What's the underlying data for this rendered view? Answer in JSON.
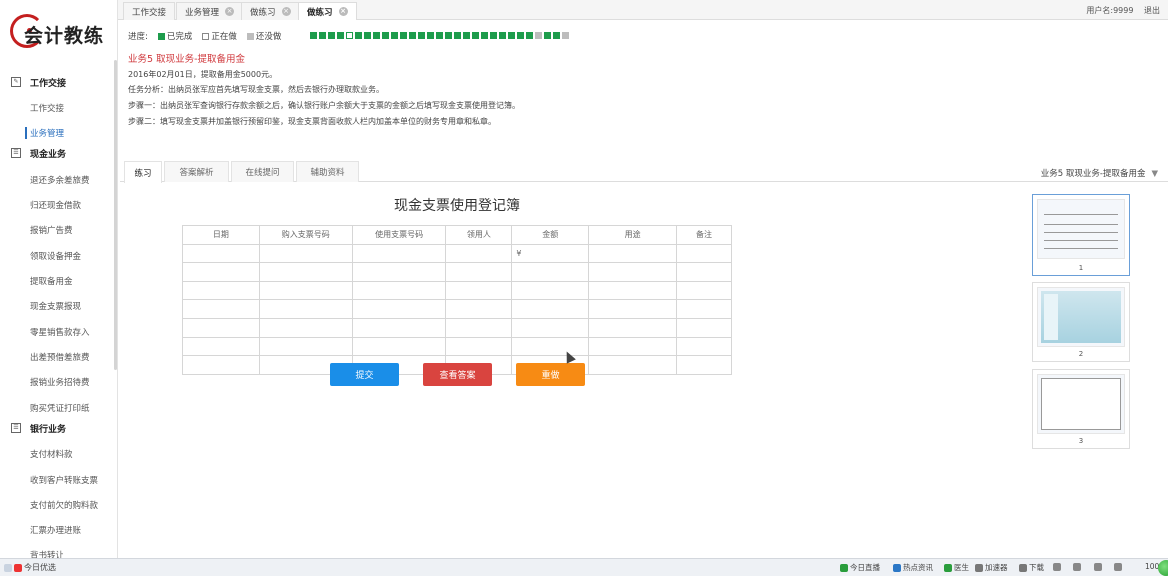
{
  "logo": {
    "text": "会计教练"
  },
  "sidebar": {
    "sections": [
      {
        "icon": "edit-icon",
        "label": "工作交接",
        "items": [
          {
            "label": "工作交接",
            "active": false
          },
          {
            "label": "业务管理",
            "active": true
          }
        ]
      },
      {
        "icon": "list-icon",
        "label": "现金业务",
        "items": [
          {
            "label": "退还多余差旅费"
          },
          {
            "label": "归还现金借款"
          },
          {
            "label": "报销广告费"
          },
          {
            "label": "领取设备押金"
          },
          {
            "label": "提取备用金"
          },
          {
            "label": "现金支票报现"
          },
          {
            "label": "零星销售款存入"
          },
          {
            "label": "出差预借差旅费"
          },
          {
            "label": "报销业务招待费"
          },
          {
            "label": "购买凭证打印纸"
          }
        ]
      },
      {
        "icon": "list-icon",
        "label": "银行业务",
        "items": [
          {
            "label": "支付材料款"
          },
          {
            "label": "收到客户转账支票"
          },
          {
            "label": "支付前欠的购料款"
          },
          {
            "label": "汇票办理进账"
          },
          {
            "label": "背书转让"
          }
        ]
      }
    ]
  },
  "tabs": [
    {
      "label": "工作交接",
      "closable": false,
      "active": false
    },
    {
      "label": "业务管理",
      "closable": true,
      "active": false
    },
    {
      "label": "做练习",
      "closable": true,
      "active": false
    },
    {
      "label": "做练习",
      "closable": true,
      "active": true
    }
  ],
  "user": {
    "name": "用户名:9999",
    "logout": "退出"
  },
  "progress": {
    "label": "进度:",
    "legend": [
      {
        "label": "已完成",
        "color": "#1e9c4c"
      },
      {
        "label": "正在做",
        "color": "#ffffff"
      },
      {
        "label": "还没做",
        "color": "#bdbdbd"
      }
    ],
    "boxes": [
      "done",
      "done",
      "done",
      "done",
      "current",
      "done",
      "done",
      "done",
      "done",
      "done",
      "done",
      "done",
      "done",
      "done",
      "done",
      "done",
      "done",
      "done",
      "done",
      "done",
      "done",
      "done",
      "done",
      "done",
      "done",
      "todo",
      "done",
      "done",
      "todo"
    ]
  },
  "task": {
    "title": "业务5 取现业务-提取备用金",
    "date_line": "2016年02月01日，提取备用金5000元。",
    "analysis": "任务分析：出纳员张军应首先填写现金支票，然后去银行办理取款业务。",
    "step1": "步骤一：出纳员张军查询银行存款余额之后，确认银行账户余额大于支票的金额之后填写现金支票使用登记簿。",
    "step2": "步骤二：填写现金支票并加盖银行预留印鉴，现金支票背面收款人栏内加盖本单位的财务专用章和私章。"
  },
  "exercise_tabs": [
    {
      "label": "练习",
      "active": true
    },
    {
      "label": "答案解析",
      "active": false
    },
    {
      "label": "在线提问",
      "active": false
    },
    {
      "label": "辅助资料",
      "active": false
    }
  ],
  "exercise_selector": {
    "value": "业务5 取现业务-提取备用金",
    "arrow": "▼"
  },
  "form": {
    "title": "现金支票使用登记簿",
    "headers": [
      "日期",
      "购入支票号码",
      "使用支票号码",
      "领用人",
      "金额",
      "用途",
      "备注"
    ],
    "currency_symbol": "¥",
    "row_count": 7
  },
  "buttons": {
    "submit": "提交",
    "answer": "查看答案",
    "redo": "重做"
  },
  "thumbnails": [
    {
      "num": "1",
      "selected": true
    },
    {
      "num": "2",
      "selected": false
    },
    {
      "num": "3",
      "selected": false
    }
  ],
  "statusbar": {
    "left": "今日优选",
    "items": [
      "今日直播",
      "热点资讯",
      "医生",
      "加速器",
      "下载",
      "100%"
    ]
  }
}
